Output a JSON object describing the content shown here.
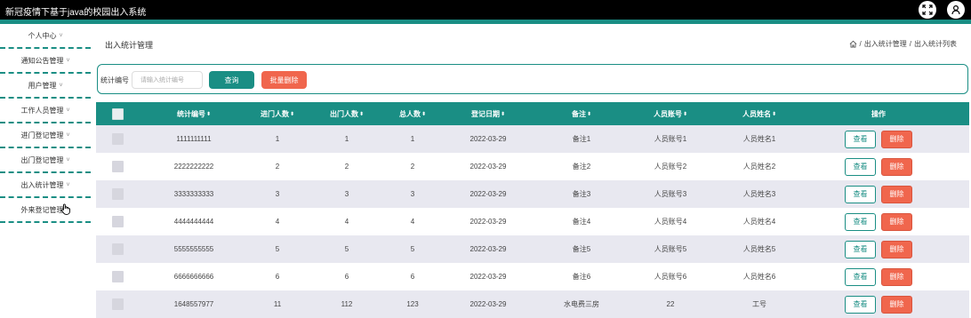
{
  "app": {
    "title": "新冠疫情下基于java的校园出入系统"
  },
  "topbar_icons": [
    "expand-icon",
    "user-icon"
  ],
  "colors": {
    "accent": "#1a8e84",
    "danger": "#f0664d",
    "topbar": "#000000",
    "row_alt": "#e8e8f0"
  },
  "sidebar": {
    "items": [
      {
        "label": "个人中心"
      },
      {
        "label": "通知公告管理"
      },
      {
        "label": "用户管理"
      },
      {
        "label": "工作人员管理"
      },
      {
        "label": "进门登记管理"
      },
      {
        "label": "出门登记管理"
      },
      {
        "label": "出入统计管理"
      },
      {
        "label": "外来登记管理"
      }
    ]
  },
  "page": {
    "title": "出入统计管理",
    "breadcrumb": [
      "出入统计管理",
      "出入统计列表"
    ],
    "breadcrumb_sep": "/"
  },
  "search": {
    "label": "统计编号",
    "placeholder": "请输入统计编号",
    "query_button": "查询",
    "batch_delete_button": "批量删除"
  },
  "table": {
    "columns": [
      "统计编号",
      "进门人数",
      "出门人数",
      "总人数",
      "登记日期",
      "备注",
      "人员账号",
      "人员姓名",
      "操作"
    ],
    "view_label": "查看",
    "delete_label": "删除",
    "rows": [
      [
        "1111111111",
        "1",
        "1",
        "1",
        "2022-03-29",
        "备注1",
        "人员账号1",
        "人员姓名1"
      ],
      [
        "2222222222",
        "2",
        "2",
        "2",
        "2022-03-29",
        "备注2",
        "人员账号2",
        "人员姓名2"
      ],
      [
        "3333333333",
        "3",
        "3",
        "3",
        "2022-03-29",
        "备注3",
        "人员账号3",
        "人员姓名3"
      ],
      [
        "4444444444",
        "4",
        "4",
        "4",
        "2022-03-29",
        "备注4",
        "人员账号4",
        "人员姓名4"
      ],
      [
        "5555555555",
        "5",
        "5",
        "5",
        "2022-03-29",
        "备注5",
        "人员账号5",
        "人员姓名5"
      ],
      [
        "6666666666",
        "6",
        "6",
        "6",
        "2022-03-29",
        "备注6",
        "人员账号6",
        "人员姓名6"
      ],
      [
        "1648557977",
        "11",
        "112",
        "123",
        "2022-03-29",
        "水电费三房",
        "22",
        "工号"
      ]
    ]
  }
}
